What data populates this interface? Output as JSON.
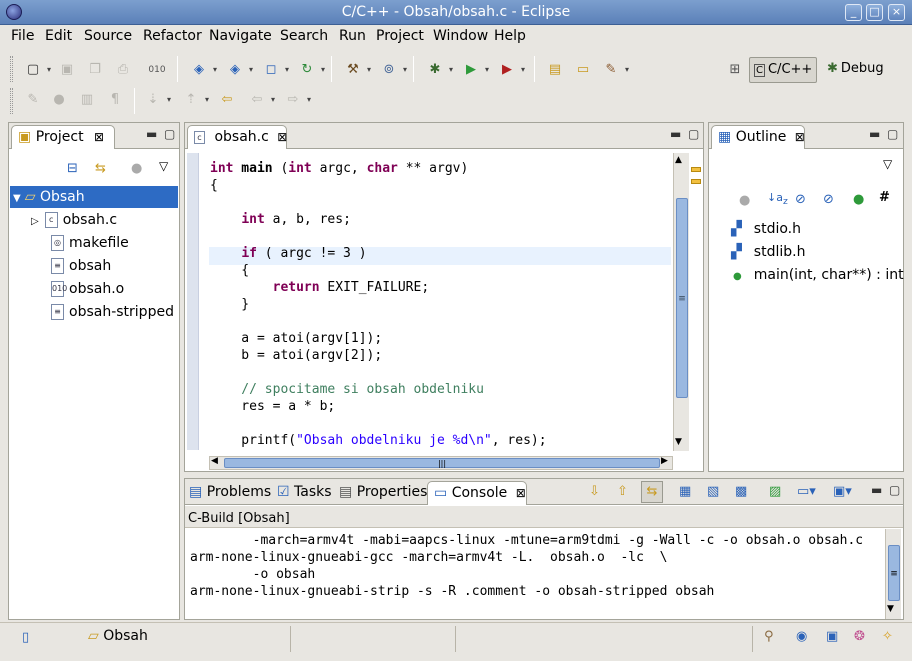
{
  "window": {
    "title": "C/C++ - Obsah/obsah.c - Eclipse",
    "controls": [
      "_",
      "□",
      "×"
    ]
  },
  "menu": [
    "File",
    "Edit",
    "Source",
    "Refactor",
    "Navigate",
    "Search",
    "Run",
    "Project",
    "Window",
    "Help"
  ],
  "perspectives": {
    "cpp": "C/C++",
    "debug": "Debug"
  },
  "project": {
    "tab": "Project",
    "root": "Obsah",
    "items": [
      "obsah.c",
      "makefile",
      "obsah",
      "obsah.o",
      "obsah-stripped"
    ],
    "badges": {
      "obsah.o": "010"
    }
  },
  "editor": {
    "tab": "obsah.c",
    "lines": [
      "int main (int argc, char ** argv)",
      "{",
      "",
      "    int a, b, res;",
      "",
      "    if ( argc != 3 )",
      "    {",
      "        return EXIT_FAILURE;",
      "    }",
      "",
      "    a = atoi(argv[1]);",
      "    b = atoi(argv[2]);",
      "",
      "    // spocitame si obsah obdelniku",
      "    res = a * b;",
      "",
      "    printf(\"Obsah obdelniku je %d\\n\", res);"
    ]
  },
  "outline": {
    "tab": "Outline",
    "items": [
      "stdio.h",
      "stdlib.h",
      "main(int, char**) : int"
    ]
  },
  "bottom": {
    "tabs": [
      "Problems",
      "Tasks",
      "Properties",
      "Console"
    ],
    "active": "Console",
    "console_title": "C-Build [Obsah]",
    "console_lines": [
      "        -march=armv4t -mabi=aapcs-linux -mtune=arm9tdmi -g -Wall -c -o obsah.o obsah.c",
      "arm-none-linux-gnueabi-gcc -march=armv4t -L.  obsah.o  -lc  \\",
      "        -o obsah",
      "arm-none-linux-gnueabi-strip -s -R .comment -o obsah-stripped obsah"
    ]
  },
  "status": {
    "project": "Obsah"
  },
  "colors": {
    "titlebar": "#5b80b8",
    "selection": "#2d6bc4",
    "keyword": "#7f0055",
    "comment": "#3f7f5f",
    "string": "#2a00ff"
  }
}
